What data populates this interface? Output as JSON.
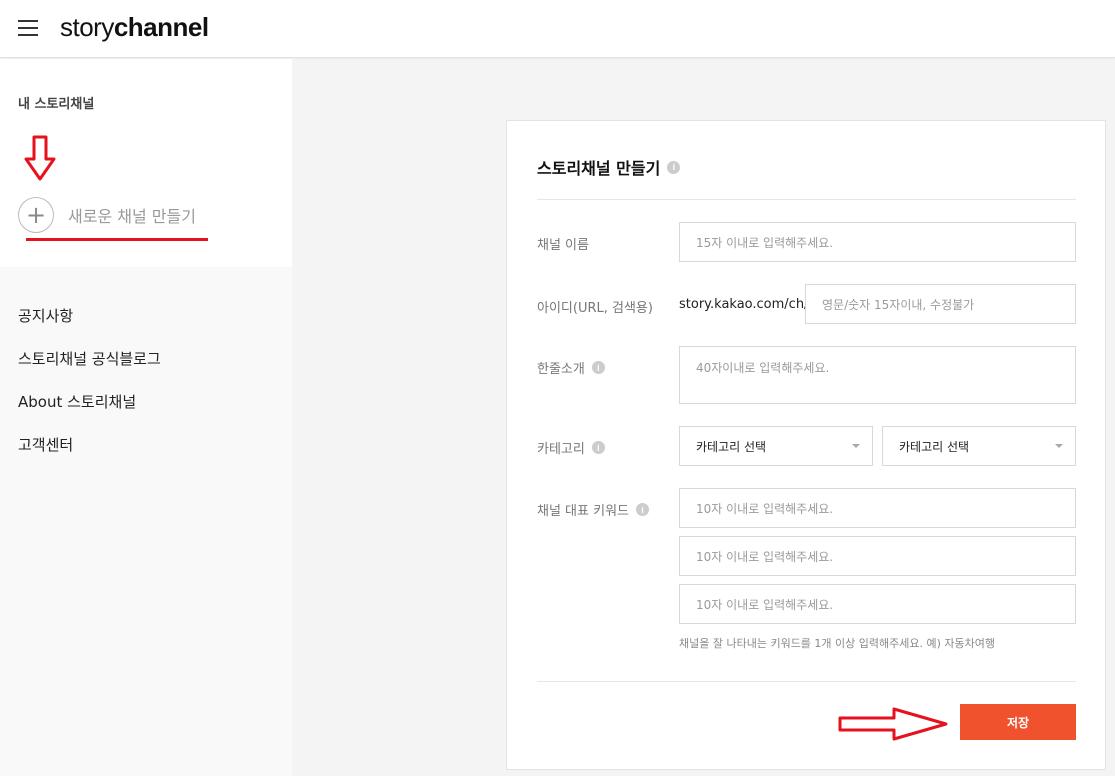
{
  "header": {
    "logo_light": "story",
    "logo_bold": "channel"
  },
  "sidebar": {
    "my_channel_title": "내 스토리채널",
    "new_channel_label": "새로운 채널 만들기",
    "plus_symbol": "+",
    "menu": [
      "공지사항",
      "스토리채널 공식블로그",
      "About 스토리채널",
      "고객센터"
    ]
  },
  "form": {
    "title": "스토리채널 만들기",
    "info_symbol": "i",
    "channel_name": {
      "label": "채널 이름",
      "placeholder": "15자 이내로 입력해주세요."
    },
    "channel_id": {
      "label": "아이디(URL, 검색용)",
      "prefix": "story.kakao.com/ch/",
      "placeholder": "영문/숫자 15자이내, 수정불가"
    },
    "intro": {
      "label": "한줄소개",
      "placeholder": "40자이내로 입력해주세요."
    },
    "category": {
      "label": "카테고리",
      "select1": "카테고리 선택",
      "select2": "카테고리 선택"
    },
    "keywords": {
      "label": "채널 대표 키워드",
      "placeholders": [
        "10자 이내로 입력해주세요.",
        "10자 이내로 입력해주세요.",
        "10자 이내로 입력해주세요."
      ],
      "help": "채널을 잘 나타내는 키워드를 1개 이상 입력해주세요. 예) 자동차여행"
    },
    "save_label": "저장"
  },
  "colors": {
    "accent": "#f0522e",
    "annotation_red": "#e5121d"
  }
}
